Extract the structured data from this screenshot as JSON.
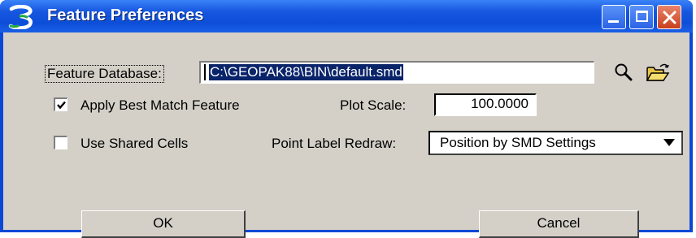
{
  "window": {
    "title": "Feature Preferences",
    "app_icon": "geopak-icon",
    "controls": [
      "minimize-icon",
      "maximize-icon",
      "close-icon"
    ]
  },
  "feature_database": {
    "label": "Feature Database:",
    "value": "C:\\GEOPAK88\\BIN\\default.smd",
    "search_icon": "magnifier-icon",
    "browse_icon": "open-folder-icon"
  },
  "apply_best_match": {
    "label": "Apply Best Match Feature",
    "checked": true
  },
  "use_shared_cells": {
    "label": "Use Shared Cells",
    "checked": false
  },
  "plot_scale": {
    "label": "Plot Scale:",
    "value": "100.0000"
  },
  "point_label_redraw": {
    "label": "Point Label Redraw:",
    "selected": "Position by SMD Settings"
  },
  "buttons": {
    "ok": "OK",
    "cancel": "Cancel"
  },
  "colors": {
    "title_bar": "#0d4ed8",
    "dialog_face": "#d4d0c8",
    "selection": "#0a246a",
    "close_button": "#d8552c"
  }
}
